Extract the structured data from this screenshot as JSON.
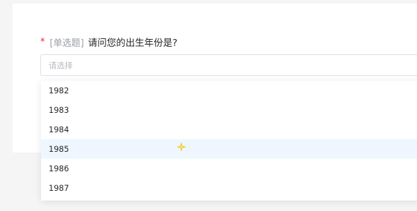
{
  "question": {
    "required_mark": "*",
    "type_label": "[单选题]",
    "text": "请问您的出生年份是?"
  },
  "select": {
    "placeholder": "请选择"
  },
  "dropdown": {
    "options": [
      "1982",
      "1983",
      "1984",
      "1985",
      "1986",
      "1987"
    ],
    "hovered_option": "1985"
  },
  "colors": {
    "required": "#f5222d",
    "hover_background": "#eef7ff",
    "cursor": "#f5c518"
  },
  "icons": {
    "cursor": "sparkle-cursor-icon"
  }
}
